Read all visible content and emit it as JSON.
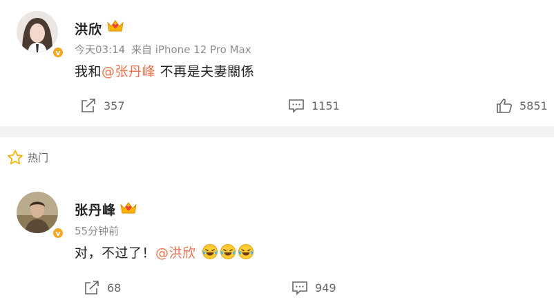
{
  "post": {
    "author": "洪欣",
    "time": "今天03:14",
    "source": "来自 iPhone 12 Pro Max",
    "text_prefix": "我和",
    "mention": "@张丹峰",
    "text_suffix": " 不再是夫妻關係",
    "repost_count": "357",
    "comment_count": "1151",
    "like_count": "5851"
  },
  "hot_section": {
    "label": "热门"
  },
  "comment": {
    "author": "张丹峰",
    "time": "55分钟前",
    "text_prefix": "对，不过了！",
    "mention": "@洪欣",
    "emojis": [
      "laugh-cry-emoji",
      "laugh-cry-emoji",
      "laugh-cry-emoji"
    ],
    "repost_count": "68",
    "comment_count": "949"
  },
  "colors": {
    "mention": "#eb7350",
    "verified_badge": "#f6a623",
    "divider": "#f2f2f2",
    "meta_text": "#8c8c8c"
  }
}
